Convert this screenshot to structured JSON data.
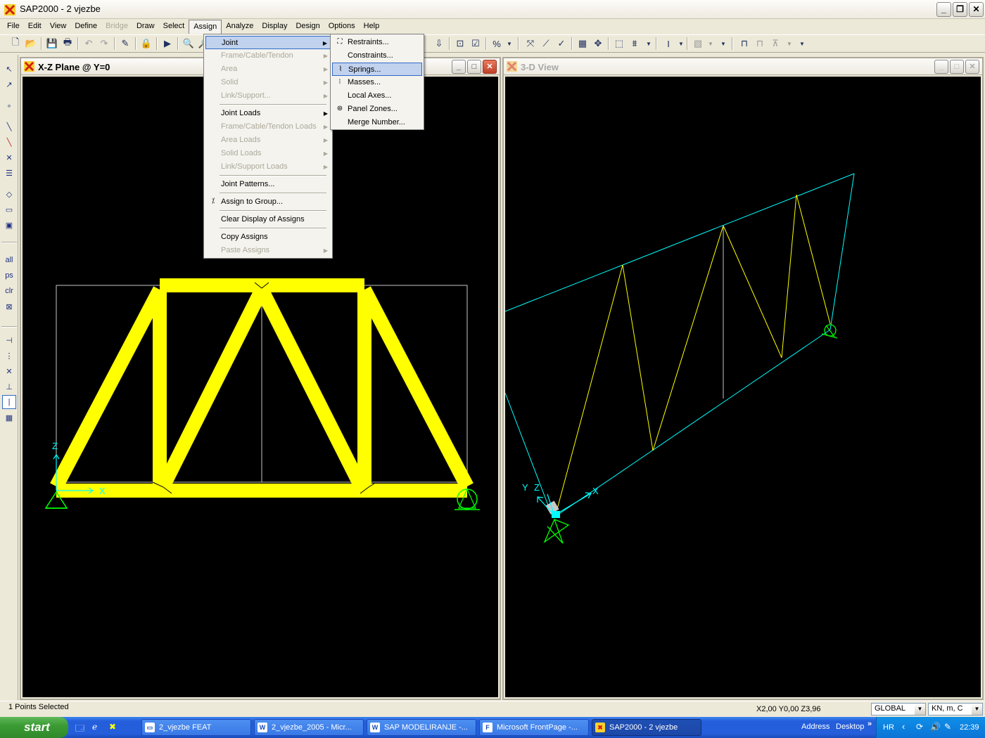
{
  "app": {
    "title": "SAP2000 - 2 vjezbe",
    "min": "_",
    "max": "❐",
    "close": "✕"
  },
  "menubar": [
    "File",
    "Edit",
    "View",
    "Define",
    "Bridge",
    "Draw",
    "Select",
    "Assign",
    "Analyze",
    "Display",
    "Design",
    "Options",
    "Help"
  ],
  "assign_menu": {
    "items": [
      {
        "label": "Joint",
        "disabled": false,
        "submenu": true,
        "highlight": true
      },
      {
        "label": "Frame/Cable/Tendon",
        "disabled": true,
        "submenu": true
      },
      {
        "label": "Area",
        "disabled": true,
        "submenu": true
      },
      {
        "label": "Solid",
        "disabled": true,
        "submenu": true
      },
      {
        "label": "Link/Support...",
        "disabled": true,
        "submenu": true
      },
      {
        "label": "Joint Loads",
        "disabled": false,
        "submenu": true
      },
      {
        "label": "Frame/Cable/Tendon Loads",
        "disabled": true,
        "submenu": true
      },
      {
        "label": "Area Loads",
        "disabled": true,
        "submenu": true
      },
      {
        "label": "Solid Loads",
        "disabled": true,
        "submenu": true
      },
      {
        "label": "Link/Support Loads",
        "disabled": true,
        "submenu": true
      },
      {
        "label": "Joint Patterns...",
        "disabled": false
      },
      {
        "label": "Assign to Group...",
        "disabled": false
      },
      {
        "label": "Clear Display of Assigns",
        "disabled": false
      },
      {
        "label": "Copy Assigns",
        "disabled": false
      },
      {
        "label": "Paste Assigns",
        "disabled": true,
        "submenu": true
      }
    ]
  },
  "joint_submenu": {
    "items": [
      {
        "label": "Restraints..."
      },
      {
        "label": "Constraints..."
      },
      {
        "label": "Springs...",
        "highlight": true
      },
      {
        "label": "Masses..."
      },
      {
        "label": "Local Axes..."
      },
      {
        "label": "Panel Zones..."
      },
      {
        "label": "Merge Number..."
      }
    ]
  },
  "left_view": {
    "title": "X-Z Plane @ Y=0",
    "axis_z": "Z",
    "axis_x": "X"
  },
  "right_view": {
    "title": "3-D View",
    "axis_y": "Y",
    "axis_z": "Z",
    "axis_x": "X"
  },
  "left_tools_labels": {
    "all": "all",
    "ps": "ps",
    "clr": "clr"
  },
  "status": {
    "selection": "1 Points Selected",
    "coords": "X2,00  Y0,00  Z3,96",
    "csys": "GLOBAL",
    "units": "KN, m, C"
  },
  "taskbar": {
    "start": "start",
    "tasks": [
      "2_vjezbe FEAT",
      "2_vjezbe_2005 - Micr...",
      "SAP  MODELIRANJE -...",
      "Microsoft FrontPage -...",
      "SAP2000 - 2 vjezbe"
    ],
    "address": "Address",
    "desktop": "Desktop",
    "lang": "HR",
    "clock": "22:39"
  },
  "colors": {
    "frame": "#ffff00",
    "support": "#00ff00",
    "axis": "#00ffff",
    "grid": "#c8c8c8"
  }
}
